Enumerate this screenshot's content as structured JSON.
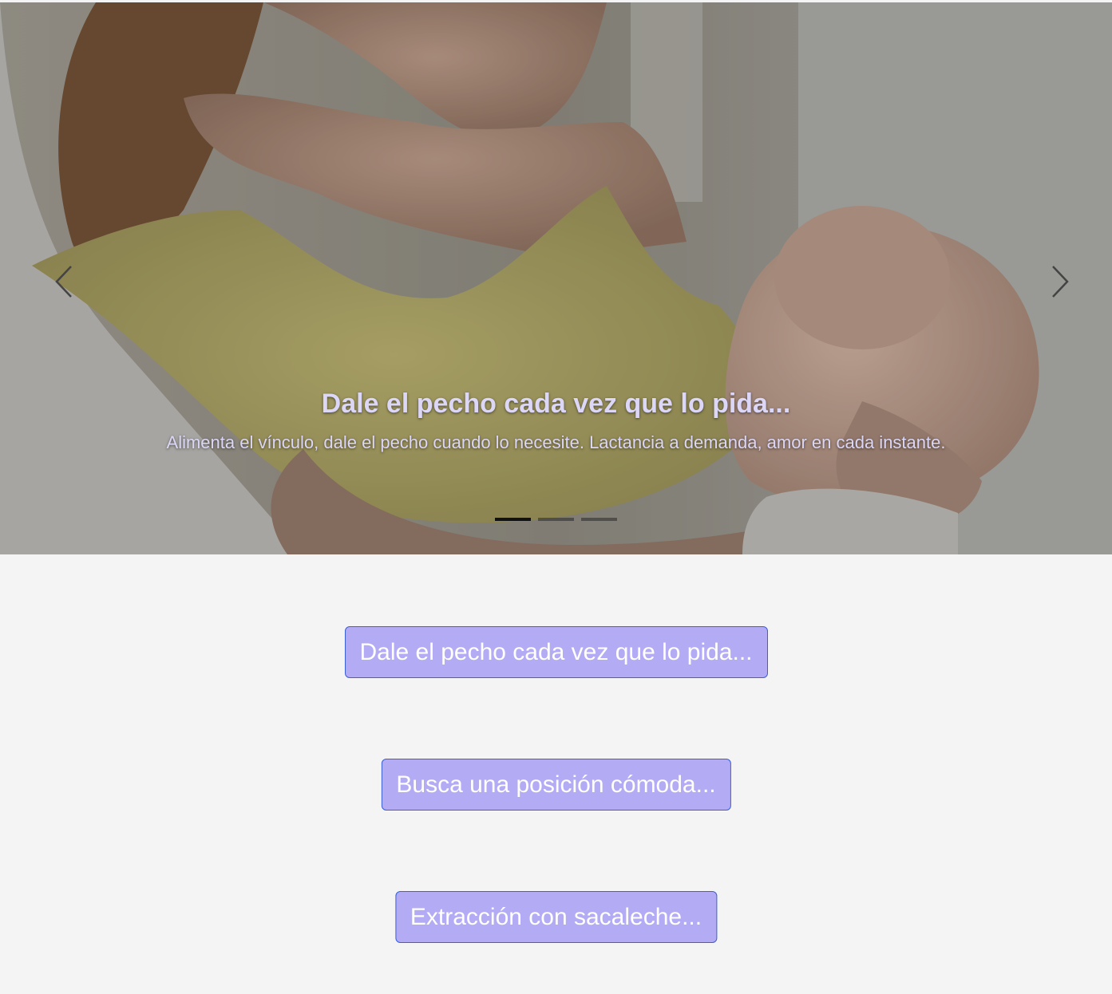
{
  "carousel": {
    "slides": [
      {
        "title": "Dale el pecho cada vez que lo pida...",
        "text": "Alimenta el vínculo, dale el pecho cuando lo necesite. Lactancia a demanda, amor en cada instante."
      }
    ],
    "active_index": 0,
    "slide_count": 3,
    "prev_icon": "chevron-left-icon",
    "next_icon": "chevron-right-icon"
  },
  "buttons": [
    {
      "label": "Dale el pecho cada vez que lo pida..."
    },
    {
      "label": "Busca una posición cómoda..."
    },
    {
      "label": "Extracción con sacaleche..."
    }
  ],
  "colors": {
    "button_bg": "#b3acf4",
    "button_border": "#3a5fd6",
    "caption_text": "#dcd6f7",
    "page_bg": "#f4f4f4"
  }
}
